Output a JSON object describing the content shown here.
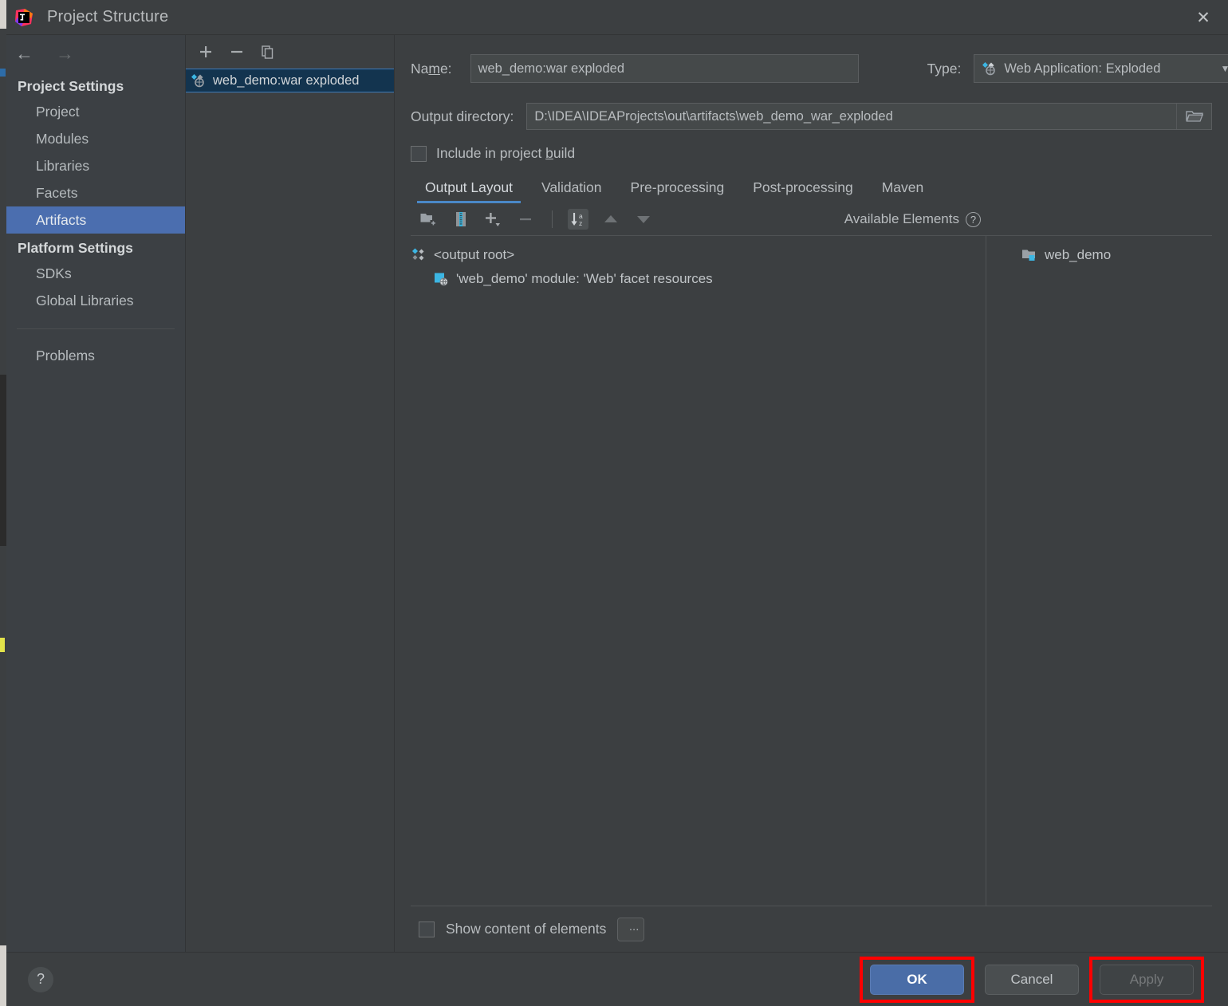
{
  "window": {
    "title": "Project Structure",
    "logo_icon": "intellij-idea-logo",
    "close_icon": "close-icon"
  },
  "nav": {
    "back_icon": "arrow-left-icon",
    "forward_icon": "arrow-right-icon",
    "groups": [
      {
        "label": "Project Settings",
        "items": [
          {
            "label": "Project",
            "selected": false
          },
          {
            "label": "Modules",
            "selected": false
          },
          {
            "label": "Libraries",
            "selected": false
          },
          {
            "label": "Facets",
            "selected": false
          },
          {
            "label": "Artifacts",
            "selected": true
          }
        ]
      },
      {
        "label": "Platform Settings",
        "items": [
          {
            "label": "SDKs",
            "selected": false
          },
          {
            "label": "Global Libraries",
            "selected": false
          }
        ]
      }
    ],
    "extra_item": {
      "label": "Problems",
      "selected": false
    }
  },
  "artifacts_list": {
    "toolbar": [
      {
        "name": "add-artifact-button",
        "glyph": "+"
      },
      {
        "name": "remove-artifact-button",
        "glyph": "−"
      },
      {
        "name": "copy-artifact-button",
        "glyph": "copy-icon"
      }
    ],
    "items": [
      {
        "label": "web_demo:war exploded",
        "icon": "artifact-exploded-icon",
        "selected": true
      }
    ]
  },
  "detail": {
    "name_label": "Name:",
    "name_value": "web_demo:war exploded",
    "type_label": "Type:",
    "type_value": "Web Application: Exploded",
    "type_icon": "artifact-exploded-icon",
    "type_caret": "chevron-down-icon",
    "output_dir_label": "Output directory:",
    "output_dir_value": "D:\\IDEA\\IDEAProjects\\out\\artifacts\\web_demo_war_exploded",
    "browse_icon": "folder-open-icon",
    "include_in_build_label": "Include in project build",
    "include_in_build_checked": false,
    "tabs": [
      {
        "label": "Output Layout",
        "active": true
      },
      {
        "label": "Validation",
        "active": false
      },
      {
        "label": "Pre-processing",
        "active": false
      },
      {
        "label": "Post-processing",
        "active": false
      },
      {
        "label": "Maven",
        "active": false
      }
    ],
    "editor_toolbar": [
      {
        "name": "create-directory-button",
        "icon": "folder-add-icon"
      },
      {
        "name": "create-archive-button",
        "icon": "archive-icon"
      },
      {
        "name": "add-element-button",
        "icon": "plus-dropdown-icon"
      },
      {
        "name": "remove-element-button",
        "icon": "minus-icon"
      },
      {
        "name": "sort-elements-button",
        "icon": "sort-alpha-icon",
        "pressed": true
      },
      {
        "name": "move-up-button",
        "icon": "arrow-up-icon"
      },
      {
        "name": "move-down-button",
        "icon": "arrow-down-icon"
      }
    ],
    "available_elements_label": "Available Elements",
    "available_elements_help_icon": "help-circle-icon",
    "output_tree": [
      {
        "label": "<output root>",
        "icon": "output-root-icon",
        "indent": 0
      },
      {
        "label": "'web_demo' module: 'Web' facet resources",
        "icon": "web-facet-icon",
        "indent": 1
      }
    ],
    "available_tree": [
      {
        "label": "web_demo",
        "icon": "module-folder-icon"
      }
    ],
    "show_content_label": "Show content of elements",
    "show_content_checked": false,
    "show_content_more_label": "..."
  },
  "footer": {
    "help_label": "?",
    "ok_label": "OK",
    "cancel_label": "Cancel",
    "apply_label": "Apply"
  },
  "colors": {
    "accent_blue": "#4a6da7",
    "selection_blue": "#4b6eaf",
    "tab_underline": "#4a88c7",
    "highlight_red": "#ff0000",
    "dialog_bg": "#3c3f41",
    "nav_bg": "#3c4044",
    "list_selected_bg": "#13344f"
  }
}
